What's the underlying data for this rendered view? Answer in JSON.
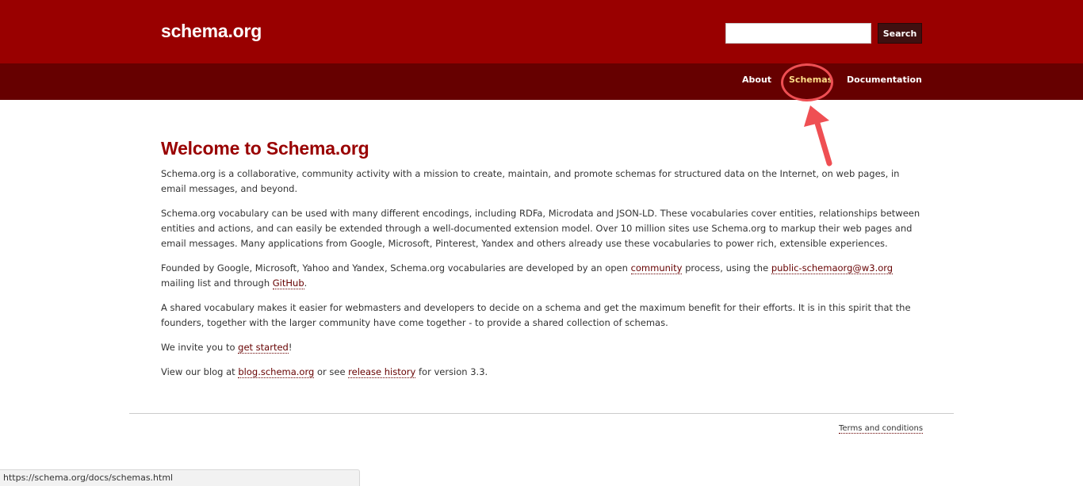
{
  "header": {
    "logo": "schema.org",
    "search": {
      "value": "",
      "placeholder": "",
      "button_label": "Search"
    }
  },
  "nav": {
    "items": [
      {
        "label": "About"
      },
      {
        "label": "Schemas",
        "highlighted": true
      },
      {
        "label": "Documentation"
      }
    ]
  },
  "main": {
    "title": "Welcome to Schema.org",
    "p1": "Schema.org is a collaborative, community activity with a mission to create, maintain, and promote schemas for structured data on the Internet, on web pages, in email messages, and beyond.",
    "p2": "Schema.org vocabulary can be used with many different encodings, including RDFa, Microdata and JSON-LD. These vocabularies cover entities, relationships between entities and actions, and can easily be extended through a well-documented extension model. Over 10 million sites use Schema.org to markup their web pages and email messages. Many applications from Google, Microsoft, Pinterest, Yandex and others already use these vocabularies to power rich, extensible experiences.",
    "p3": {
      "t1": "Founded by Google, Microsoft, Yahoo and Yandex, Schema.org vocabularies are developed by an open ",
      "link_community": "community",
      "t2": " process, using the ",
      "link_mailing": "public-schemaorg@w3.org",
      "t3": " mailing list and through ",
      "link_github": "GitHub",
      "t4": "."
    },
    "p4": "A shared vocabulary makes it easier for webmasters and developers to decide on a schema and get the maximum benefit for their efforts. It is in this spirit that the founders, together with the larger community have come together - to provide a shared collection of schemas.",
    "p5": {
      "t1": "We invite you to ",
      "link": "get started",
      "t2": "!"
    },
    "p6": {
      "t1": "View our blog at ",
      "link_blog": "blog.schema.org",
      "t2": " or see ",
      "link_release": "release history",
      "t3": " for version 3.3."
    }
  },
  "footer": {
    "terms": "Terms and conditions"
  },
  "status_bar": {
    "url": "https://schema.org/docs/schemas.html"
  },
  "colors": {
    "header_bg": "#990000",
    "nav_bg": "#660000",
    "title": "#990000",
    "nav_active": "#ffdd88",
    "annotation": "#ef4f53"
  },
  "annotation": {
    "shape": "circle-and-arrow",
    "target": "Schemas"
  }
}
